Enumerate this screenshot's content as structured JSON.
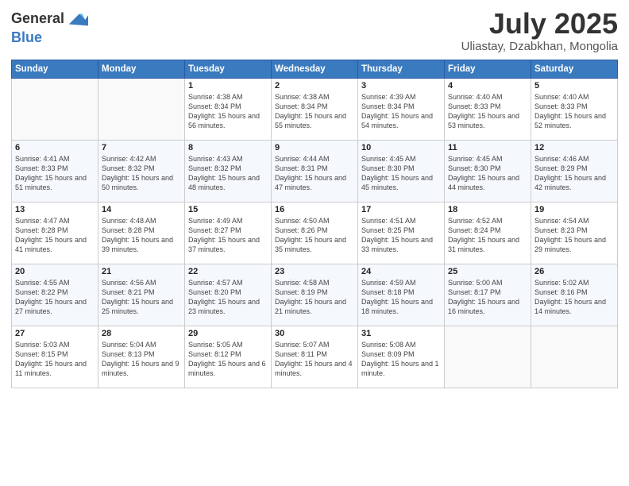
{
  "logo": {
    "general": "General",
    "blue": "Blue"
  },
  "title": "July 2025",
  "location": "Uliastay, Dzabkhan, Mongolia",
  "days_of_week": [
    "Sunday",
    "Monday",
    "Tuesday",
    "Wednesday",
    "Thursday",
    "Friday",
    "Saturday"
  ],
  "weeks": [
    [
      {
        "day": "",
        "sunrise": "",
        "sunset": "",
        "daylight": ""
      },
      {
        "day": "",
        "sunrise": "",
        "sunset": "",
        "daylight": ""
      },
      {
        "day": "1",
        "sunrise": "Sunrise: 4:38 AM",
        "sunset": "Sunset: 8:34 PM",
        "daylight": "Daylight: 15 hours and 56 minutes."
      },
      {
        "day": "2",
        "sunrise": "Sunrise: 4:38 AM",
        "sunset": "Sunset: 8:34 PM",
        "daylight": "Daylight: 15 hours and 55 minutes."
      },
      {
        "day": "3",
        "sunrise": "Sunrise: 4:39 AM",
        "sunset": "Sunset: 8:34 PM",
        "daylight": "Daylight: 15 hours and 54 minutes."
      },
      {
        "day": "4",
        "sunrise": "Sunrise: 4:40 AM",
        "sunset": "Sunset: 8:33 PM",
        "daylight": "Daylight: 15 hours and 53 minutes."
      },
      {
        "day": "5",
        "sunrise": "Sunrise: 4:40 AM",
        "sunset": "Sunset: 8:33 PM",
        "daylight": "Daylight: 15 hours and 52 minutes."
      }
    ],
    [
      {
        "day": "6",
        "sunrise": "Sunrise: 4:41 AM",
        "sunset": "Sunset: 8:33 PM",
        "daylight": "Daylight: 15 hours and 51 minutes."
      },
      {
        "day": "7",
        "sunrise": "Sunrise: 4:42 AM",
        "sunset": "Sunset: 8:32 PM",
        "daylight": "Daylight: 15 hours and 50 minutes."
      },
      {
        "day": "8",
        "sunrise": "Sunrise: 4:43 AM",
        "sunset": "Sunset: 8:32 PM",
        "daylight": "Daylight: 15 hours and 48 minutes."
      },
      {
        "day": "9",
        "sunrise": "Sunrise: 4:44 AM",
        "sunset": "Sunset: 8:31 PM",
        "daylight": "Daylight: 15 hours and 47 minutes."
      },
      {
        "day": "10",
        "sunrise": "Sunrise: 4:45 AM",
        "sunset": "Sunset: 8:30 PM",
        "daylight": "Daylight: 15 hours and 45 minutes."
      },
      {
        "day": "11",
        "sunrise": "Sunrise: 4:45 AM",
        "sunset": "Sunset: 8:30 PM",
        "daylight": "Daylight: 15 hours and 44 minutes."
      },
      {
        "day": "12",
        "sunrise": "Sunrise: 4:46 AM",
        "sunset": "Sunset: 8:29 PM",
        "daylight": "Daylight: 15 hours and 42 minutes."
      }
    ],
    [
      {
        "day": "13",
        "sunrise": "Sunrise: 4:47 AM",
        "sunset": "Sunset: 8:28 PM",
        "daylight": "Daylight: 15 hours and 41 minutes."
      },
      {
        "day": "14",
        "sunrise": "Sunrise: 4:48 AM",
        "sunset": "Sunset: 8:28 PM",
        "daylight": "Daylight: 15 hours and 39 minutes."
      },
      {
        "day": "15",
        "sunrise": "Sunrise: 4:49 AM",
        "sunset": "Sunset: 8:27 PM",
        "daylight": "Daylight: 15 hours and 37 minutes."
      },
      {
        "day": "16",
        "sunrise": "Sunrise: 4:50 AM",
        "sunset": "Sunset: 8:26 PM",
        "daylight": "Daylight: 15 hours and 35 minutes."
      },
      {
        "day": "17",
        "sunrise": "Sunrise: 4:51 AM",
        "sunset": "Sunset: 8:25 PM",
        "daylight": "Daylight: 15 hours and 33 minutes."
      },
      {
        "day": "18",
        "sunrise": "Sunrise: 4:52 AM",
        "sunset": "Sunset: 8:24 PM",
        "daylight": "Daylight: 15 hours and 31 minutes."
      },
      {
        "day": "19",
        "sunrise": "Sunrise: 4:54 AM",
        "sunset": "Sunset: 8:23 PM",
        "daylight": "Daylight: 15 hours and 29 minutes."
      }
    ],
    [
      {
        "day": "20",
        "sunrise": "Sunrise: 4:55 AM",
        "sunset": "Sunset: 8:22 PM",
        "daylight": "Daylight: 15 hours and 27 minutes."
      },
      {
        "day": "21",
        "sunrise": "Sunrise: 4:56 AM",
        "sunset": "Sunset: 8:21 PM",
        "daylight": "Daylight: 15 hours and 25 minutes."
      },
      {
        "day": "22",
        "sunrise": "Sunrise: 4:57 AM",
        "sunset": "Sunset: 8:20 PM",
        "daylight": "Daylight: 15 hours and 23 minutes."
      },
      {
        "day": "23",
        "sunrise": "Sunrise: 4:58 AM",
        "sunset": "Sunset: 8:19 PM",
        "daylight": "Daylight: 15 hours and 21 minutes."
      },
      {
        "day": "24",
        "sunrise": "Sunrise: 4:59 AM",
        "sunset": "Sunset: 8:18 PM",
        "daylight": "Daylight: 15 hours and 18 minutes."
      },
      {
        "day": "25",
        "sunrise": "Sunrise: 5:00 AM",
        "sunset": "Sunset: 8:17 PM",
        "daylight": "Daylight: 15 hours and 16 minutes."
      },
      {
        "day": "26",
        "sunrise": "Sunrise: 5:02 AM",
        "sunset": "Sunset: 8:16 PM",
        "daylight": "Daylight: 15 hours and 14 minutes."
      }
    ],
    [
      {
        "day": "27",
        "sunrise": "Sunrise: 5:03 AM",
        "sunset": "Sunset: 8:15 PM",
        "daylight": "Daylight: 15 hours and 11 minutes."
      },
      {
        "day": "28",
        "sunrise": "Sunrise: 5:04 AM",
        "sunset": "Sunset: 8:13 PM",
        "daylight": "Daylight: 15 hours and 9 minutes."
      },
      {
        "day": "29",
        "sunrise": "Sunrise: 5:05 AM",
        "sunset": "Sunset: 8:12 PM",
        "daylight": "Daylight: 15 hours and 6 minutes."
      },
      {
        "day": "30",
        "sunrise": "Sunrise: 5:07 AM",
        "sunset": "Sunset: 8:11 PM",
        "daylight": "Daylight: 15 hours and 4 minutes."
      },
      {
        "day": "31",
        "sunrise": "Sunrise: 5:08 AM",
        "sunset": "Sunset: 8:09 PM",
        "daylight": "Daylight: 15 hours and 1 minute."
      },
      {
        "day": "",
        "sunrise": "",
        "sunset": "",
        "daylight": ""
      },
      {
        "day": "",
        "sunrise": "",
        "sunset": "",
        "daylight": ""
      }
    ]
  ]
}
